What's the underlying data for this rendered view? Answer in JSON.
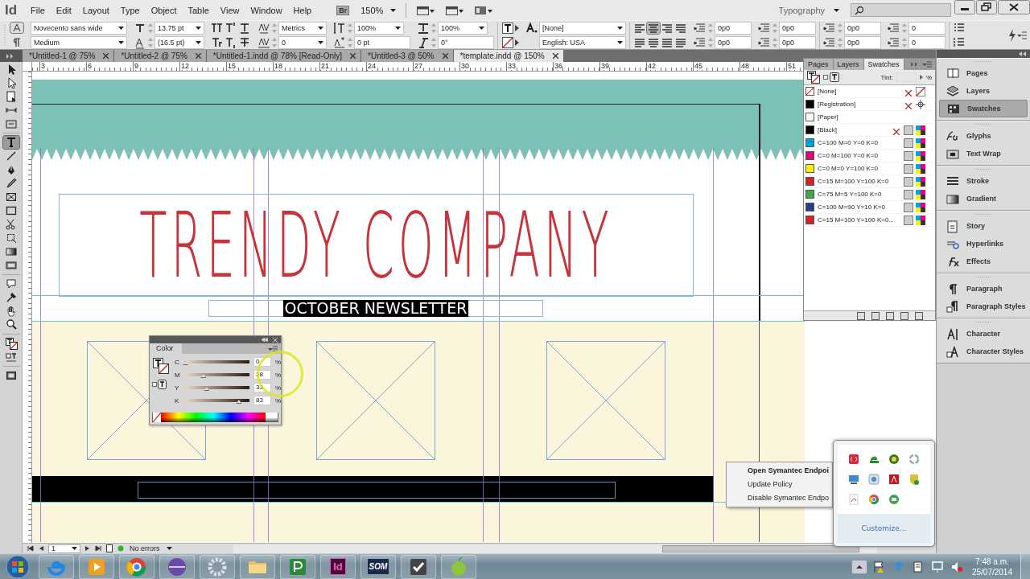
{
  "menubar": {
    "logo": "Id",
    "menus": [
      "File",
      "Edit",
      "Layout",
      "Type",
      "Object",
      "Table",
      "View",
      "Window",
      "Help"
    ],
    "bridge": "Br",
    "zoom": "150%",
    "workspace": "Typography"
  },
  "control_bar": {
    "font_family": "Novecento sans wide",
    "font_style": "Medium",
    "font_size": "13.75 pt",
    "leading": "(16.5 pt)",
    "kerning": "Metrics",
    "tracking": "0",
    "vertical_scale": "100%",
    "horizontal_scale": "100%",
    "baseline_shift": "0 pt",
    "skew": "0°",
    "character_style": "[None]",
    "language": "English: USA",
    "alignment": [
      {
        "selected": false
      },
      {
        "selected": true
      },
      {
        "selected": false
      },
      {
        "selected": false
      },
      {
        "selected": false
      },
      {
        "selected": false
      },
      {
        "selected": false
      },
      {
        "selected": false
      }
    ],
    "spacing_fields": [
      "0p0",
      "0p0",
      "0p0",
      "0p0",
      "0p0",
      "0p0",
      "0",
      "0"
    ]
  },
  "tabs": [
    {
      "label": "*Untitled-1 @ 75%",
      "selected": false
    },
    {
      "label": "*Untitled-2 @ 75%",
      "selected": false
    },
    {
      "label": "*Untitled-1.indd @ 78% [Read-Only]",
      "selected": false
    },
    {
      "label": "*Untitled-3 @ 50%",
      "selected": false
    },
    {
      "label": "*template.indd @ 150%",
      "selected": true
    }
  ],
  "ruler": {
    "marks": [
      "3",
      "6",
      "9",
      "12",
      "15",
      "18",
      "21",
      "24",
      "27",
      "30",
      "33",
      "36",
      "39",
      "42",
      "45",
      "48",
      "51"
    ]
  },
  "tools": [
    {
      "kind": "selection",
      "selected": false
    },
    {
      "kind": "direct",
      "selected": false
    },
    {
      "kind": "page",
      "selected": false
    },
    {
      "kind": "gap",
      "selected": false
    },
    {
      "kind": "collector",
      "selected": false
    },
    {
      "kind": "type",
      "selected": true
    },
    {
      "kind": "line",
      "selected": false
    },
    {
      "kind": "pen",
      "selected": false
    },
    {
      "kind": "pencil",
      "selected": false
    },
    {
      "kind": "frame",
      "selected": false
    },
    {
      "kind": "rect",
      "selected": false
    },
    {
      "kind": "scissors",
      "selected": false
    },
    {
      "kind": "transform",
      "selected": false
    },
    {
      "kind": "gradient",
      "selected": false
    },
    {
      "kind": "feather",
      "selected": false
    },
    {
      "kind": "note",
      "selected": false
    },
    {
      "kind": "eyedropper",
      "selected": false
    },
    {
      "kind": "hand",
      "selected": false
    },
    {
      "kind": "zoom",
      "selected": false
    },
    {
      "kind": "fillstroke",
      "selected": false
    },
    {
      "kind": "format",
      "selected": false
    },
    {
      "kind": "mode",
      "selected": false
    }
  ],
  "document": {
    "title": "TRENDY COMPANY",
    "subtitle": "OCTOBER NEWSLETTER",
    "subtitle_selected": true
  },
  "swatches_panel": {
    "tabs": [
      {
        "label": "Pages",
        "selected": false
      },
      {
        "label": "Layers",
        "selected": false
      },
      {
        "label": "Swatches",
        "selected": true
      }
    ],
    "tint_label": "Tint:",
    "tint_unit": "%",
    "swatches": [
      {
        "name": "[None]",
        "kind": "none"
      },
      {
        "name": "[Registration]",
        "kind": "registration",
        "color": "#000000"
      },
      {
        "name": "[Paper]",
        "kind": "paper",
        "color": "#ffffff"
      },
      {
        "name": "[Black]",
        "kind": "black",
        "color": "#000000"
      },
      {
        "name": "C=100 M=0 Y=0 K=0",
        "kind": "process",
        "color": "#00a0e3"
      },
      {
        "name": "C=0 M=100 Y=0 K=0",
        "kind": "process",
        "color": "#e4007c"
      },
      {
        "name": "C=0 M=0 Y=100 K=0",
        "kind": "process",
        "color": "#fff200"
      },
      {
        "name": "C=15 M=100 Y=100 K=0",
        "kind": "process",
        "color": "#d2232a"
      },
      {
        "name": "C=75 M=5 Y=100 K=0",
        "kind": "process",
        "color": "#3aaa48"
      },
      {
        "name": "C=100 M=90 Y=10 K=0",
        "kind": "process",
        "color": "#263e8e"
      },
      {
        "name": "C=15 M=100 Y=100 K=0...",
        "kind": "process",
        "color": "#d2232b"
      }
    ]
  },
  "dock": {
    "groups": [
      [
        {
          "label": "Pages",
          "kind": "pages",
          "selected": false
        },
        {
          "label": "Layers",
          "kind": "layers",
          "selected": false
        },
        {
          "label": "Swatches",
          "kind": "swatches",
          "selected": true
        }
      ],
      [
        {
          "label": "Glyphs",
          "kind": "glyphs",
          "selected": false
        },
        {
          "label": "Text Wrap",
          "kind": "wrap",
          "selected": false
        }
      ],
      [
        {
          "label": "Stroke",
          "kind": "stroke",
          "selected": false
        },
        {
          "label": "Gradient",
          "kind": "gradient",
          "selected": false
        }
      ],
      [
        {
          "label": "Story",
          "kind": "story",
          "selected": false
        },
        {
          "label": "Hyperlinks",
          "kind": "link",
          "selected": false
        },
        {
          "label": "Effects",
          "kind": "fx",
          "selected": false
        }
      ],
      [
        {
          "label": "Paragraph",
          "kind": "para",
          "selected": false
        },
        {
          "label": "Paragraph Styles",
          "kind": "parastyle",
          "selected": false
        }
      ],
      [
        {
          "label": "Character",
          "kind": "char",
          "selected": false
        },
        {
          "label": "Character Styles",
          "kind": "charstyle",
          "selected": false
        }
      ]
    ]
  },
  "color_panel": {
    "title": "Color",
    "channels": [
      {
        "label": "C",
        "level": 0,
        "reading": "0",
        "unit": "%"
      },
      {
        "label": "M",
        "level": 0.28,
        "reading": "28",
        "unit": "%"
      },
      {
        "label": "Y",
        "level": 0.33,
        "reading": "33",
        "unit": "%"
      },
      {
        "label": "K",
        "level": 0.83,
        "reading": "83",
        "unit": "%"
      }
    ]
  },
  "context_menu": {
    "items": [
      {
        "label": "Open Symantec Endpoi",
        "default": true
      },
      {
        "label": "Update Policy",
        "default": false
      },
      {
        "label": "Disable Symantec Endpo",
        "default": false
      }
    ]
  },
  "tray_popup": {
    "customize": "Customize..."
  },
  "status_bar": {
    "page": "1",
    "preflight": "No errors"
  },
  "taskbar": {
    "apps": [
      {
        "kind": "ie"
      },
      {
        "kind": "media"
      },
      {
        "kind": "chrome"
      },
      {
        "kind": "orb"
      },
      {
        "kind": "gear"
      },
      {
        "kind": "folder"
      },
      {
        "kind": "publisher"
      },
      {
        "kind": "indesign",
        "label": "Id"
      },
      {
        "kind": "som",
        "label": "SOM"
      },
      {
        "kind": "check"
      },
      {
        "kind": "apple"
      }
    ],
    "time": "7:48 a.m.",
    "date": "25/07/2014"
  }
}
